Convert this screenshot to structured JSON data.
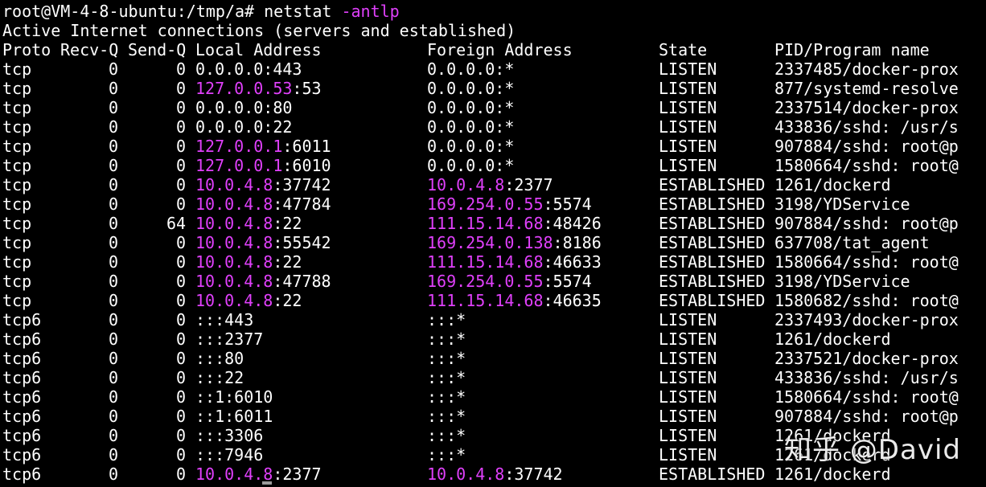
{
  "prompt": {
    "user_host": "root@VM-4-8-ubuntu:/tmp/a#",
    "command": "netstat",
    "option": "-antlp"
  },
  "banner": "Active Internet connections (servers and established)",
  "columns": {
    "proto": "Proto",
    "recv_q": "Recv-Q",
    "send_q": "Send-Q",
    "local": "Local Address",
    "foreign": "Foreign Address",
    "state": "State",
    "pid": "PID/Program name"
  },
  "rows": [
    {
      "proto": "tcp",
      "recv": "0",
      "send": "0",
      "local_ip": "0.0.0.0",
      "local_port": ":443",
      "local_hl": false,
      "foreign_ip": "0.0.0.0",
      "foreign_port": ":*",
      "foreign_hl": false,
      "state": "LISTEN",
      "pid": "2337485/docker-prox"
    },
    {
      "proto": "tcp",
      "recv": "0",
      "send": "0",
      "local_ip": "127.0.0.53",
      "local_port": ":53",
      "local_hl": true,
      "foreign_ip": "0.0.0.0",
      "foreign_port": ":*",
      "foreign_hl": false,
      "state": "LISTEN",
      "pid": "877/systemd-resolve"
    },
    {
      "proto": "tcp",
      "recv": "0",
      "send": "0",
      "local_ip": "0.0.0.0",
      "local_port": ":80",
      "local_hl": false,
      "foreign_ip": "0.0.0.0",
      "foreign_port": ":*",
      "foreign_hl": false,
      "state": "LISTEN",
      "pid": "2337514/docker-prox"
    },
    {
      "proto": "tcp",
      "recv": "0",
      "send": "0",
      "local_ip": "0.0.0.0",
      "local_port": ":22",
      "local_hl": false,
      "foreign_ip": "0.0.0.0",
      "foreign_port": ":*",
      "foreign_hl": false,
      "state": "LISTEN",
      "pid": "433836/sshd: /usr/s"
    },
    {
      "proto": "tcp",
      "recv": "0",
      "send": "0",
      "local_ip": "127.0.0.1",
      "local_port": ":6011",
      "local_hl": true,
      "foreign_ip": "0.0.0.0",
      "foreign_port": ":*",
      "foreign_hl": false,
      "state": "LISTEN",
      "pid": "907884/sshd: root@p"
    },
    {
      "proto": "tcp",
      "recv": "0",
      "send": "0",
      "local_ip": "127.0.0.1",
      "local_port": ":6010",
      "local_hl": true,
      "foreign_ip": "0.0.0.0",
      "foreign_port": ":*",
      "foreign_hl": false,
      "state": "LISTEN",
      "pid": "1580664/sshd: root@"
    },
    {
      "proto": "tcp",
      "recv": "0",
      "send": "0",
      "local_ip": "10.0.4.8",
      "local_port": ":37742",
      "local_hl": true,
      "foreign_ip": "10.0.4.8",
      "foreign_port": ":2377",
      "foreign_hl": true,
      "state": "ESTABLISHED",
      "pid": "1261/dockerd"
    },
    {
      "proto": "tcp",
      "recv": "0",
      "send": "0",
      "local_ip": "10.0.4.8",
      "local_port": ":47784",
      "local_hl": true,
      "foreign_ip": "169.254.0.55",
      "foreign_port": ":5574",
      "foreign_hl": true,
      "state": "ESTABLISHED",
      "pid": "3198/YDService"
    },
    {
      "proto": "tcp",
      "recv": "0",
      "send": "64",
      "local_ip": "10.0.4.8",
      "local_port": ":22",
      "local_hl": true,
      "foreign_ip": "111.15.14.68",
      "foreign_port": ":48426",
      "foreign_hl": true,
      "state": "ESTABLISHED",
      "pid": "907884/sshd: root@p"
    },
    {
      "proto": "tcp",
      "recv": "0",
      "send": "0",
      "local_ip": "10.0.4.8",
      "local_port": ":55542",
      "local_hl": true,
      "foreign_ip": "169.254.0.138",
      "foreign_port": ":8186",
      "foreign_hl": true,
      "state": "ESTABLISHED",
      "pid": "637708/tat_agent"
    },
    {
      "proto": "tcp",
      "recv": "0",
      "send": "0",
      "local_ip": "10.0.4.8",
      "local_port": ":22",
      "local_hl": true,
      "foreign_ip": "111.15.14.68",
      "foreign_port": ":46633",
      "foreign_hl": true,
      "state": "ESTABLISHED",
      "pid": "1580664/sshd: root@"
    },
    {
      "proto": "tcp",
      "recv": "0",
      "send": "0",
      "local_ip": "10.0.4.8",
      "local_port": ":47788",
      "local_hl": true,
      "foreign_ip": "169.254.0.55",
      "foreign_port": ":5574",
      "foreign_hl": true,
      "state": "ESTABLISHED",
      "pid": "3198/YDService"
    },
    {
      "proto": "tcp",
      "recv": "0",
      "send": "0",
      "local_ip": "10.0.4.8",
      "local_port": ":22",
      "local_hl": true,
      "foreign_ip": "111.15.14.68",
      "foreign_port": ":46635",
      "foreign_hl": true,
      "state": "ESTABLISHED",
      "pid": "1580682/sshd: root@"
    },
    {
      "proto": "tcp6",
      "recv": "0",
      "send": "0",
      "local_ip": "",
      "local_port": ":::443",
      "local_hl": false,
      "foreign_ip": "",
      "foreign_port": ":::*",
      "foreign_hl": false,
      "state": "LISTEN",
      "pid": "2337493/docker-prox"
    },
    {
      "proto": "tcp6",
      "recv": "0",
      "send": "0",
      "local_ip": "",
      "local_port": ":::2377",
      "local_hl": false,
      "foreign_ip": "",
      "foreign_port": ":::*",
      "foreign_hl": false,
      "state": "LISTEN",
      "pid": "1261/dockerd"
    },
    {
      "proto": "tcp6",
      "recv": "0",
      "send": "0",
      "local_ip": "",
      "local_port": ":::80",
      "local_hl": false,
      "foreign_ip": "",
      "foreign_port": ":::*",
      "foreign_hl": false,
      "state": "LISTEN",
      "pid": "2337521/docker-prox"
    },
    {
      "proto": "tcp6",
      "recv": "0",
      "send": "0",
      "local_ip": "",
      "local_port": ":::22",
      "local_hl": false,
      "foreign_ip": "",
      "foreign_port": ":::*",
      "foreign_hl": false,
      "state": "LISTEN",
      "pid": "433836/sshd: /usr/s"
    },
    {
      "proto": "tcp6",
      "recv": "0",
      "send": "0",
      "local_ip": "",
      "local_port": "::1:6010",
      "local_hl": false,
      "foreign_ip": "",
      "foreign_port": ":::*",
      "foreign_hl": false,
      "state": "LISTEN",
      "pid": "1580664/sshd: root@"
    },
    {
      "proto": "tcp6",
      "recv": "0",
      "send": "0",
      "local_ip": "",
      "local_port": "::1:6011",
      "local_hl": false,
      "foreign_ip": "",
      "foreign_port": ":::*",
      "foreign_hl": false,
      "state": "LISTEN",
      "pid": "907884/sshd: root@p"
    },
    {
      "proto": "tcp6",
      "recv": "0",
      "send": "0",
      "local_ip": "",
      "local_port": ":::3306",
      "local_hl": false,
      "foreign_ip": "",
      "foreign_port": ":::*",
      "foreign_hl": false,
      "state": "LISTEN",
      "pid": "1261/dockerd"
    },
    {
      "proto": "tcp6",
      "recv": "0",
      "send": "0",
      "local_ip": "",
      "local_port": ":::7946",
      "local_hl": false,
      "foreign_ip": "",
      "foreign_port": ":::*",
      "foreign_hl": false,
      "state": "LISTEN",
      "pid": "1261/dockerd"
    },
    {
      "proto": "tcp6",
      "recv": "0",
      "send": "0",
      "local_ip": "10.0.4.8",
      "local_port": ":2377",
      "local_hl": true,
      "foreign_ip": "10.0.4.8",
      "foreign_port": ":37742",
      "foreign_hl": true,
      "state": "ESTABLISHED",
      "pid": "1261/dockerd"
    }
  ],
  "watermark": "知乎 @David",
  "colors": {
    "background": "#000000",
    "text": "#ffffff",
    "highlight": "#e040fb"
  }
}
